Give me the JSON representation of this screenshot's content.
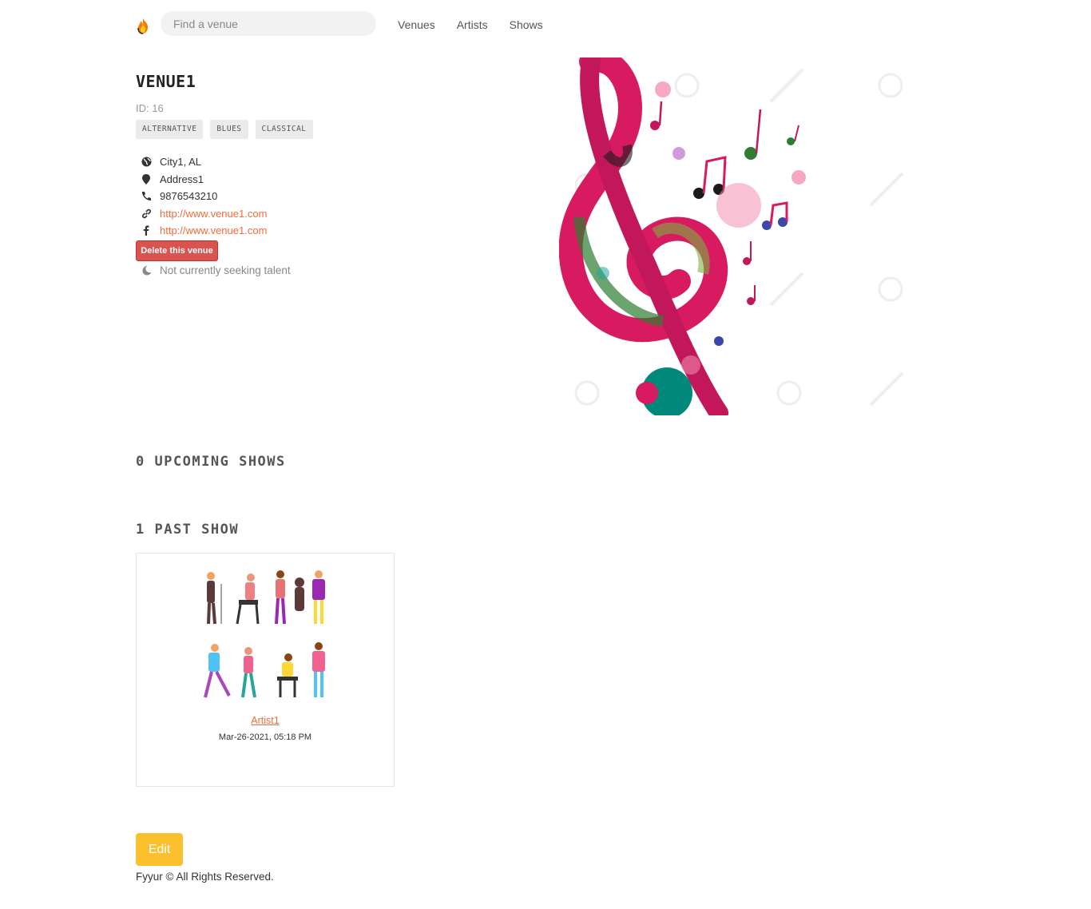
{
  "nav": {
    "search_placeholder": "Find a venue",
    "links": [
      "Venues",
      "Artists",
      "Shows"
    ]
  },
  "venue": {
    "name": "VENUE1",
    "id_text": "ID: 16",
    "genres": [
      "ALTERNATIVE",
      "BLUES",
      "CLASSICAL"
    ],
    "city_state": "City1, AL",
    "address": "Address1",
    "phone": "9876543210",
    "website": "http://www.venue1.com",
    "facebook": "http://www.venue1.com",
    "seeking": "Not currently seeking talent"
  },
  "actions": {
    "delete_label": "Delete this venue",
    "edit_label": "Edit"
  },
  "sections": {
    "upcoming_title": "0 UPCOMING SHOWS",
    "past_title": "1 PAST SHOW"
  },
  "past_shows": [
    {
      "artist": "Artist1",
      "date": "Mar-26-2021, 05:18 PM"
    }
  ],
  "footer": {
    "text": "Fyyur © All Rights Reserved."
  },
  "colors": {
    "accent": "#f26b3a",
    "danger": "#d9534f",
    "edit": "#fbc02d"
  }
}
